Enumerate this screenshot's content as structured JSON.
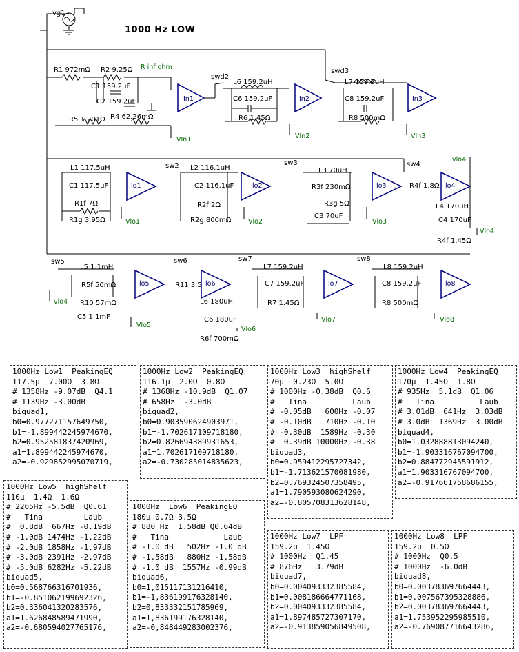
{
  "title": "1000 Hz   LOW",
  "schematic": {
    "source": "vg1",
    "row1": [
      "R1 972mΩ",
      "R2 9.25Ω",
      "R inf ohm",
      "C1 159.2uF",
      "C2 159.2uF",
      "R5 1.201Ω",
      "R4 62.26mΩ",
      "In1",
      "VIn1",
      "swd2",
      "L6  159.2uH",
      "C6  159.2uF",
      "R6  1.45Ω",
      "In2",
      "VIn2",
      "swd3",
      "L7  159.2uH",
      "C8  159.2uF",
      "R8  500mΩ",
      "In3",
      "VIn3"
    ],
    "row2": [
      "L1  117.5uH",
      "C1  117.5uF",
      "R1f  7Ω",
      "R1g  3.95Ω",
      "lo1",
      "Vlo1",
      "sw2",
      "L2 116.1uH",
      "C2 116.1uF",
      "R2f  2Ω",
      "R2g 800mΩ",
      "lo2",
      "Vlo2",
      "sw3",
      "L3  70uH",
      "R3f  230mΩ",
      "R3g 5Ω",
      "C3  70uF",
      "lo3",
      "Vlo3",
      "sw4",
      "R4f 1.8Ω",
      "lo4",
      "vlo4",
      "L4  170uH",
      "C4  170uF",
      "R4f  1.45Ω",
      "Vlo4"
    ],
    "row3": [
      "sw5",
      "L5  1.1mH",
      "R5f  50mΩ",
      "R10 57mΩ",
      "C5  1.1mF",
      "vlo4",
      "lo5",
      "Vlo5",
      "sw6",
      "R11 3.5Ω",
      "lo6",
      "L6  180uH",
      "C6  180uF",
      "R6f  700mΩ",
      "Vlo6",
      "sw7",
      "L7  159.2uH",
      "C7  159.2uF",
      "R7  1.45Ω",
      "lo7",
      "Vlo7",
      "sw8",
      "L8  159.2uH",
      "C8  159.2uF",
      "R8  500mΩ",
      "lo8",
      "Vlo8"
    ]
  },
  "annotations": [
    {
      "id": "low1",
      "lines": [
        "1000Hz Low1  PeakingEQ",
        "117.5µ  7.00Ω  3.8Ω",
        "# 1358Hz -9.07dB  Q4.1",
        "# 1139Hz -3.00dB",
        "biquad1,",
        "b0=0.977271157649750,",
        "b1=-1.899442245974670,",
        "b2=0.952581837420969,",
        "a1=1.899442245974670,",
        "a2=-0.929852995070719,"
      ]
    },
    {
      "id": "low2",
      "lines": [
        "1000Hz Low2  PeakingEQ",
        "116.1µ  2.0Ω  0.8Ω",
        "# 1368Hz -10.9dB  Q1.07",
        "# 658Hz  -3.0dB",
        "biquad2,",
        "b0=0.903590624903971,",
        "b1=-1.702617109718180,",
        "b2=0.826694389931653,",
        "a1=1.702617109718180,",
        "a2=-0.730285014835623,"
      ]
    },
    {
      "id": "low3",
      "lines": [
        "1000Hz Low3  highShelf",
        "70µ  0.23Ω  5.0Ω",
        "# 1000Hz -0.38dB  Q0.6",
        "#   Tina          Laub",
        "# -0.05dB   600Hz -0.07",
        "# -0.10dB   710Hz -0.10",
        "# -0.30dB  1589Hz -0.30",
        "#  0.39dB 10000Hz -0.38",
        "biquad3,",
        "b0=0.959412295727342,",
        "b1=-1.713621570081980,",
        "b2=0.769324507358495,",
        "a1=1.790593080624290,",
        "a2=-0.805708313628148,"
      ]
    },
    {
      "id": "low4",
      "lines": [
        "1000Hz Low4  PeakingEQ",
        "170µ  1.45Ω  1.8Ω",
        "# 935Hz  5.1dB  Q1.06",
        "#   Tina          Laub",
        "# 3.01dB  641Hz  3.03dB",
        "# 3.0dB  1369Hz  3.00dB",
        "biquad4,",
        "b0=1.032888813094240,",
        "b1=-1.903316767094700,",
        "b2=0.884772945591912,",
        "a1=1.903316767094700,",
        "a2=-0.917661758686155,"
      ]
    },
    {
      "id": "low5",
      "lines": [
        "1000Hz Low5  highShelf",
        "110µ  1.4Ω  1.6Ω",
        "# 2265Hz -5.5dB  Q0.61",
        "#   Tina         Laub",
        "#  0.8dB  667Hz -0.19dB",
        "# -1.0dB 1474Hz -1.22dB",
        "# -2.0dB 1858Hz -1.97dB",
        "# -3.0dB 2391Hz -2.97dB",
        "# -5.0dB 6282Hz -5.22dB",
        "biquad5,",
        "b0=0.568766316701936,",
        "b1=-0.851062199692326,",
        "b2=0.336041320283576,",
        "a1=1.626848589471990,",
        "a2=-0.680594027765176,"
      ]
    },
    {
      "id": "low6",
      "lines": [
        "1000Hz  Low6  PeakingEQ",
        "180µ 0.7Ω 3.5Ω",
        "# 880 Hz  1.58dB Q0.64dB",
        "#   Tina            Laub",
        "# -1.0 dB   502Hz -1.0 dB",
        "# -1.58dB   880Hz -1.58dB",
        "# -1.0 dB  1557Hz -0.99dB",
        "biquad6,",
        "b0=1,015117131216410,",
        "b1=-1,836199176328140,",
        "b2=0,833332151785969,",
        "a1=1,836199176328140,",
        "a2=-0,848449283002376,"
      ]
    },
    {
      "id": "low7",
      "lines": [
        "1000Hz Low7  LPF",
        "159.2µ  1.45Ω",
        "# 1000Hz  Q1.45",
        "# 876Hz   3.79dB",
        "biquad7,",
        "b0=0.004093332385584,",
        "b1=0.008186664771168,",
        "b2=0.004093332385584,",
        "a1=1.897485727307170,",
        "a2=-0.913859056849508,"
      ]
    },
    {
      "id": "low8",
      "lines": [
        "1000Hz Low8  LPF",
        "159.2µ  0.5Ω",
        "# 1000Hz  Q0.5",
        "# 1000Hz  -6.0dB",
        "biquad8,",
        "b0=0.003783697664443,",
        "b1=0.007567395328886,",
        "b2=0.003783697664443,",
        "a1=1.753952295985510,",
        "a2=-0.769087716643286,"
      ]
    }
  ]
}
